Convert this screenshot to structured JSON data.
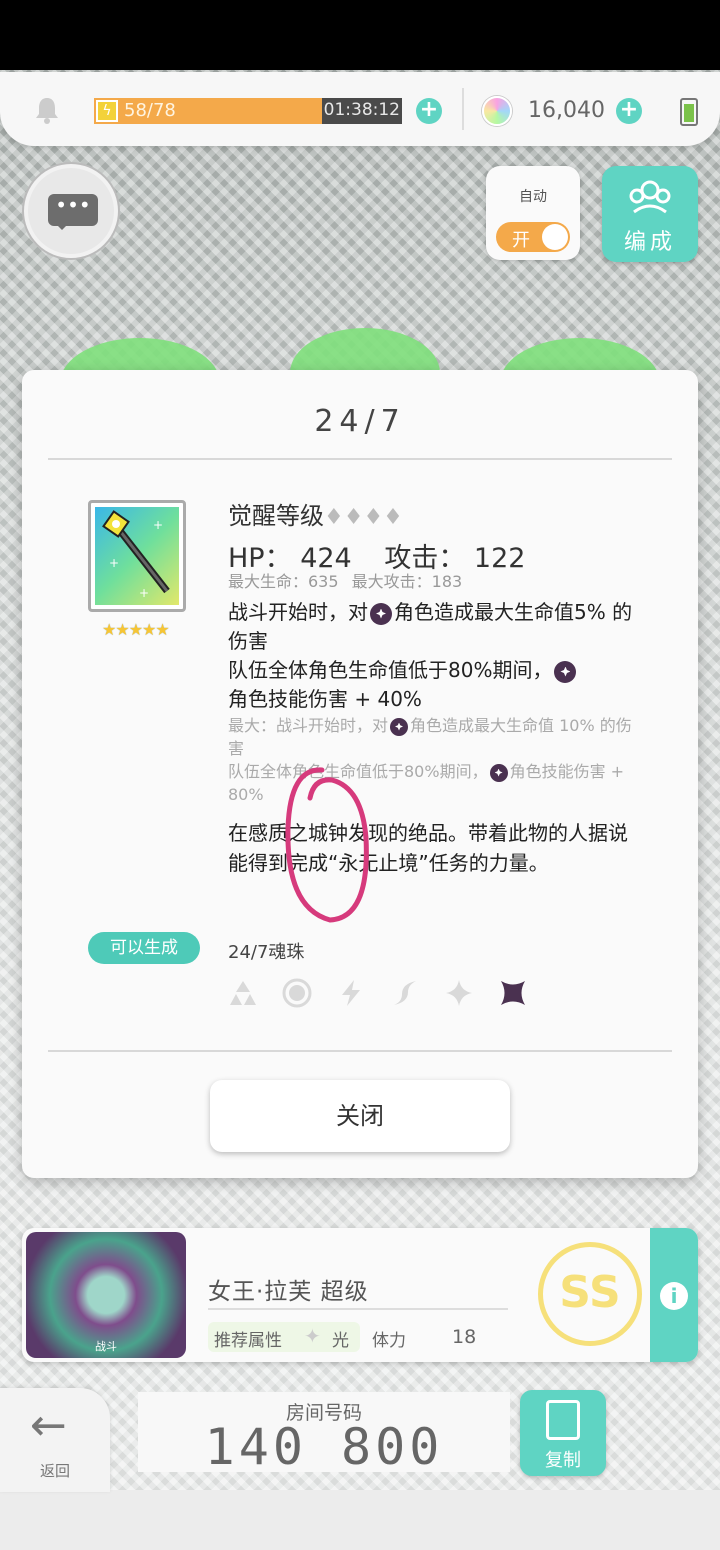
{
  "status": {
    "stamina_text": "58/78",
    "stamina_fraction": 0.74,
    "timer": "01:38:12",
    "gems": "16,040"
  },
  "controls": {
    "auto_label": "自动",
    "toggle_state": "开",
    "formation_label": "编成"
  },
  "modal": {
    "title": "24/7",
    "awaken_label": "觉醒等级",
    "diamonds": "♦♦♦♦",
    "hp_label": "HP：",
    "hp_value": "424",
    "atk_label": "攻击：",
    "atk_value": "122",
    "max_hp": "最大生命：635",
    "max_atk": "最大攻击：183",
    "desc_part1": "战斗开始时，对",
    "desc_part2": "角色造成最大生命值5% 的伤害",
    "desc_part3": "队伍全体角色生命值低于80%期间，",
    "desc_part4": "角色技能伤害 + 40%",
    "max_desc_part1": "最大：战斗开始时，对",
    "max_desc_part2": "角色造成最大生命值 10% 的伤害",
    "max_desc_part3": "队伍全体角色生命值低于80%期间，",
    "max_desc_part4": "角色技能伤害 + 80%",
    "flavor": "在感质之城钟发现的绝品。带着此物的人据说能得到完成“永无止境”任务的力量。",
    "can_make": "可以生成",
    "orb_name": "24/7魂珠",
    "stars": "★★★★★",
    "close_label": "关闭"
  },
  "quest": {
    "boss_tag": "战斗",
    "name": "女王·拉芙 超级",
    "recommended_label": "推荐属性",
    "recommended_attr": "光",
    "stamina_label": "体力",
    "stamina_cost": "18",
    "rank": "SS"
  },
  "footer": {
    "back_label": "返回",
    "room_label": "房间号码",
    "room_number": "140 800",
    "copy_label": "复制"
  },
  "colors": {
    "accent": "#5fd4c3",
    "stamina": "#f4a94a",
    "dark_attr": "#4a3150"
  }
}
